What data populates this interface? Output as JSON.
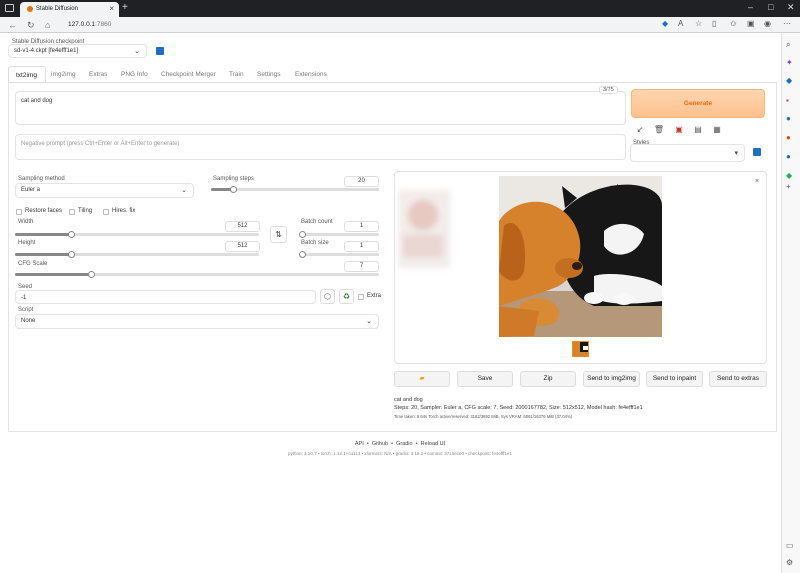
{
  "browser": {
    "tab_title": "Stable Diffusion",
    "url_host": "127.0.0.1",
    "url_port": ":7860"
  },
  "checkpoint": {
    "label": "Stable Diffusion checkpoint",
    "value": "sd-v1-4.ckpt [fe4efff1e1]"
  },
  "tabs": [
    "txt2img",
    "img2img",
    "Extras",
    "PNG Info",
    "Checkpoint Merger",
    "Train",
    "Settings",
    "Extensions"
  ],
  "prompt": {
    "value": "cat and dog",
    "counter": "3/75"
  },
  "negative_prompt": {
    "placeholder": "Negative prompt (press Ctrl+Enter or Alt+Enter to generate)"
  },
  "generate_label": "Generate",
  "styles_label": "Styles",
  "sampling": {
    "method_label": "Sampling method",
    "method_value": "Euler a",
    "steps_label": "Sampling steps",
    "steps_value": "20",
    "steps_fraction": 0.13
  },
  "checkboxes": {
    "restore_faces": "Restore faces",
    "tiling": "Tiling",
    "hires_fix": "Hires. fix",
    "extra": "Extra"
  },
  "width": {
    "label": "Width",
    "value": "512",
    "fraction": 0.23
  },
  "height": {
    "label": "Height",
    "value": "512",
    "fraction": 0.23
  },
  "batch_count": {
    "label": "Batch count",
    "value": "1",
    "fraction": 0
  },
  "batch_size": {
    "label": "Batch size",
    "value": "1",
    "fraction": 0
  },
  "cfg": {
    "label": "CFG Scale",
    "value": "7",
    "fraction": 0.21
  },
  "seed": {
    "label": "Seed",
    "value": "-1"
  },
  "script": {
    "label": "Script",
    "value": "None"
  },
  "actions": [
    "Save",
    "Zip",
    "Send to img2img",
    "Send to inpaint",
    "Send to extras"
  ],
  "info": {
    "prompt": "cat and dog",
    "params": "Steps: 20, Sampler: Euler a, CFG scale: 7, Seed: 2000167782, Size: 512x512, Model hash: fe4efff1e1",
    "timing": "Time taken: 6.64s  Torch active/reserved: 3162/3692 MiB, Sys VRAM: 6061/16376 MiB (37.04%)"
  },
  "footer": {
    "links": [
      "API",
      "Github",
      "Gradio",
      "Reload UI"
    ],
    "versions": "python: 3.10.7  •  torch: 1.12.1+cu113  •  xformers: N/A  •  gradio: 3.16.2  •  commit: 3715ece0  •  checkpoint: fe4efff1e1"
  },
  "icons": {
    "accent": "#1e6fc4",
    "generate_bg": "#fec08e",
    "generate_text": "#f06a0a"
  }
}
